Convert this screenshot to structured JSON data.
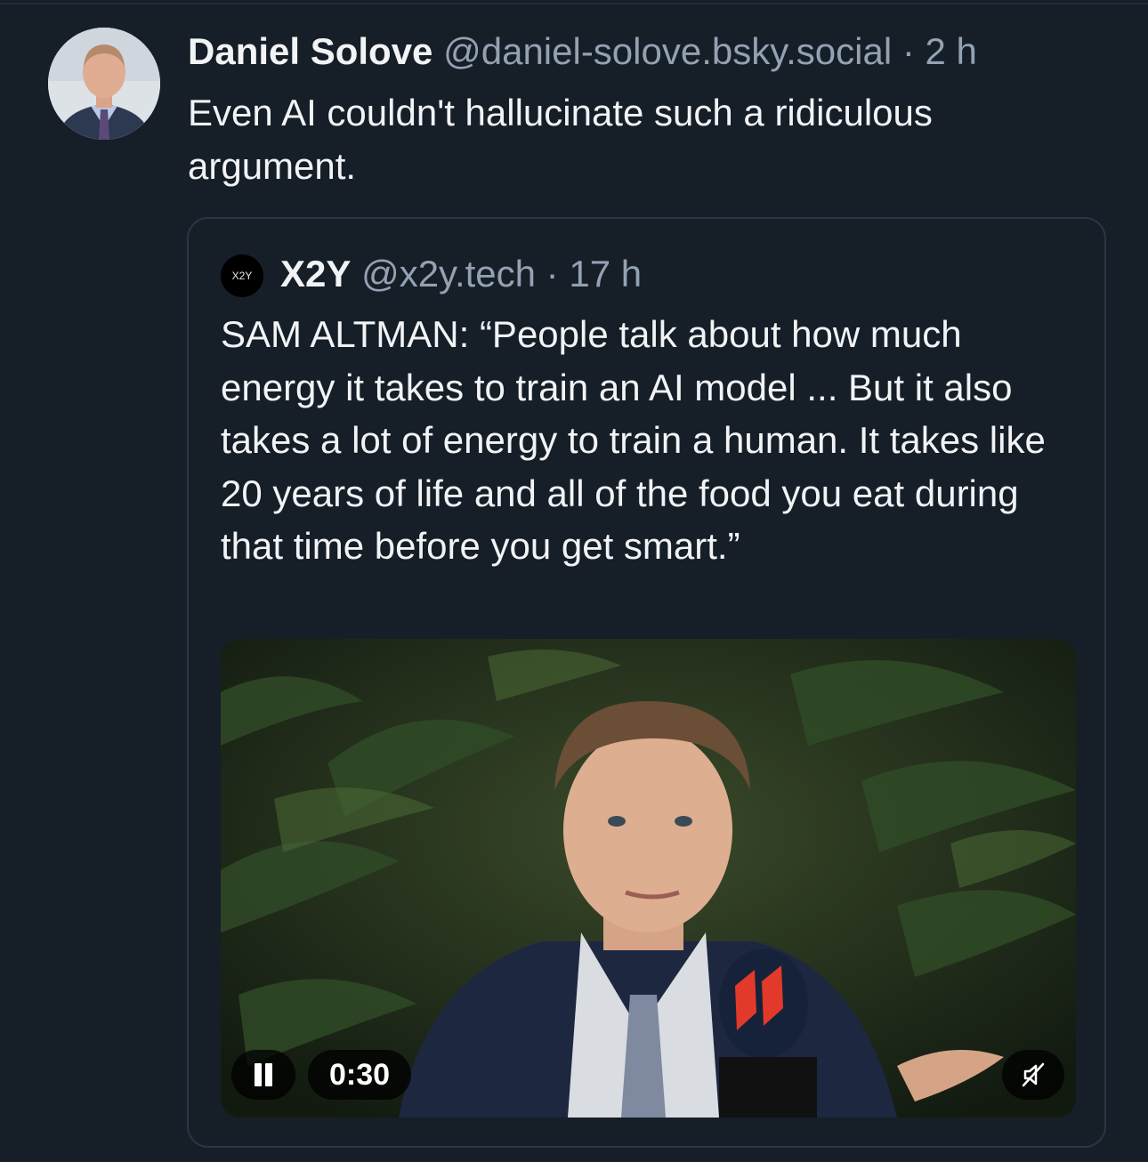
{
  "post": {
    "author_name": "Daniel Solove",
    "author_handle": "@daniel-solove.bsky.social",
    "separator": "·",
    "time": "2 h",
    "text": "Even AI couldn't hallucinate such a ridiculous argument."
  },
  "quote": {
    "avatar_label": "X2Y",
    "author_name": "X2Y",
    "author_handle": "@x2y.tech",
    "separator": "·",
    "time": "17 h",
    "text": "SAM ALTMAN: “People talk about how much energy it takes to train an AI model ... But it also takes a lot of energy to train a human. It takes like 20 years of life and all of the food you eat during that time before you get smart.”"
  },
  "video": {
    "timestamp": "0:30",
    "state": "playing",
    "muted": true,
    "icons": [
      "pause-icon",
      "muted-speaker-icon"
    ]
  },
  "colors": {
    "background": "#161e27",
    "text_primary": "#f1f3f5",
    "text_secondary": "#93a2b3",
    "card_border": "#2a3643"
  }
}
